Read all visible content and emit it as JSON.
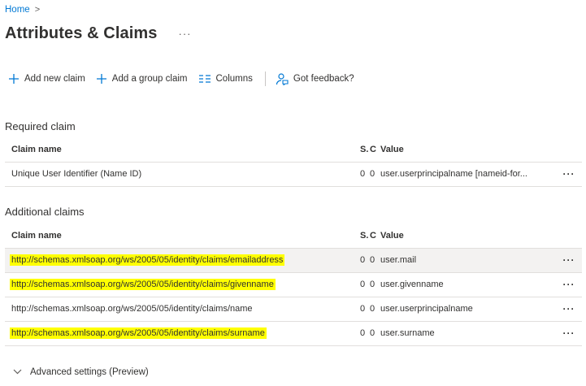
{
  "breadcrumb": {
    "home": "Home",
    "separator": ">"
  },
  "page": {
    "title": "Attributes & Claims",
    "more": "···"
  },
  "toolbar": {
    "add_claim": "Add new claim",
    "add_group_claim": "Add a group claim",
    "columns": "Columns",
    "feedback": "Got feedback?"
  },
  "columns": {
    "name": "Claim name",
    "s": "S.",
    "c": "C",
    "value": "Value"
  },
  "required": {
    "title": "Required claim",
    "rows": [
      {
        "name": "Unique User Identifier (Name ID)",
        "s": "0",
        "c": "0",
        "value": "user.userprincipalname [nameid-for...",
        "more": "···"
      }
    ]
  },
  "additional": {
    "title": "Additional claims",
    "rows": [
      {
        "name": "http://schemas.xmlsoap.org/ws/2005/05/identity/claims/emailaddress",
        "s": "0",
        "c": "0",
        "value": "user.mail",
        "more": "···"
      },
      {
        "name": "http://schemas.xmlsoap.org/ws/2005/05/identity/claims/givenname",
        "s": "0",
        "c": "0",
        "value": "user.givenname",
        "more": "···"
      },
      {
        "name": "http://schemas.xmlsoap.org/ws/2005/05/identity/claims/name",
        "s": "0",
        "c": "0",
        "value": "user.userprincipalname",
        "more": "···"
      },
      {
        "name": "http://schemas.xmlsoap.org/ws/2005/05/identity/claims/surname",
        "s": "0",
        "c": "0",
        "value": "user.surname",
        "more": "···"
      }
    ]
  },
  "advanced": {
    "label": "Advanced settings (Preview)"
  },
  "colors": {
    "accent": "#0078d4",
    "highlight": "#ffff00",
    "selected_row": "#f3f2f1"
  }
}
